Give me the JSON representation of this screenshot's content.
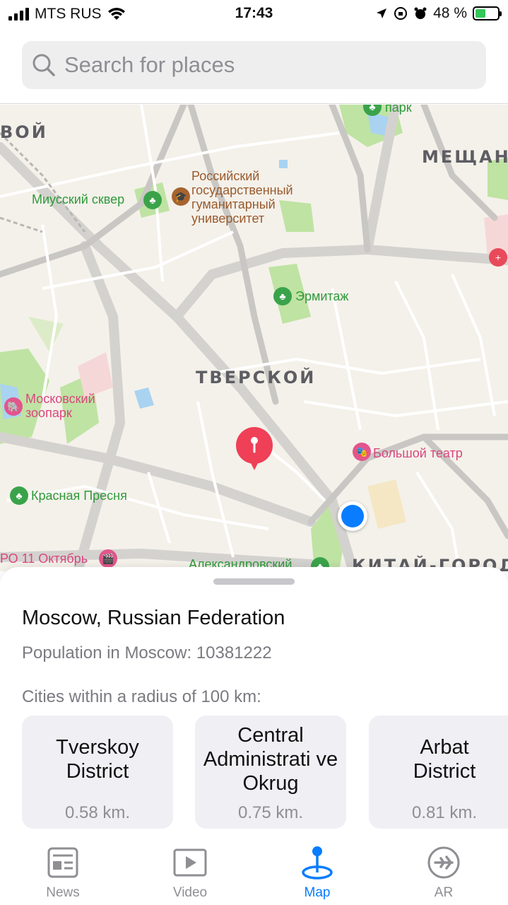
{
  "status_bar": {
    "carrier": "MTS RUS",
    "time": "17:43",
    "battery_percent": "48 %",
    "battery_level": 0.48
  },
  "search": {
    "placeholder": "Search for places"
  },
  "map": {
    "districts": [
      "ВОЙ",
      "МЕЩАНС",
      "ТВЕРСКОЙ",
      "КИТАЙ-ГОРОД"
    ],
    "labels": {
      "park": "парк",
      "miussky": "Миусский сквер",
      "university": "Российский\nгосударственный\nгуманитарный\nуниверситет",
      "hermitage": "Эрмитаж",
      "zoo": "Московский\nзоопарк",
      "bolshoi": "Большой театр",
      "krasnaya": "Красная Пресня",
      "oktyabr": "РО 11 Октябрь",
      "alexandrovsky": "Александровский"
    }
  },
  "sheet": {
    "title": "Moscow, Russian Federation",
    "population": "Population in Moscow: 10381222",
    "cities_label": "Cities within a radius of 100 km:",
    "cities": [
      {
        "name": "Tverskoy District",
        "distance": "0.58 km."
      },
      {
        "name": "Central Administrati ve Okrug",
        "distance": "0.75 km."
      },
      {
        "name": "Arbat District",
        "distance": "0.81 km."
      }
    ]
  },
  "tabs": [
    {
      "label": "News",
      "icon": "news-icon",
      "active": false
    },
    {
      "label": "Video",
      "icon": "video-icon",
      "active": false
    },
    {
      "label": "Map",
      "icon": "map-pin-icon",
      "active": true
    },
    {
      "label": "AR",
      "icon": "airplane-icon",
      "active": false
    }
  ],
  "colors": {
    "accent": "#0a7cff",
    "map_background": "#f4f1ea",
    "park_green": "#bfe3a3",
    "poi_green": "#3aa34a",
    "poi_pink": "#e3558c"
  }
}
